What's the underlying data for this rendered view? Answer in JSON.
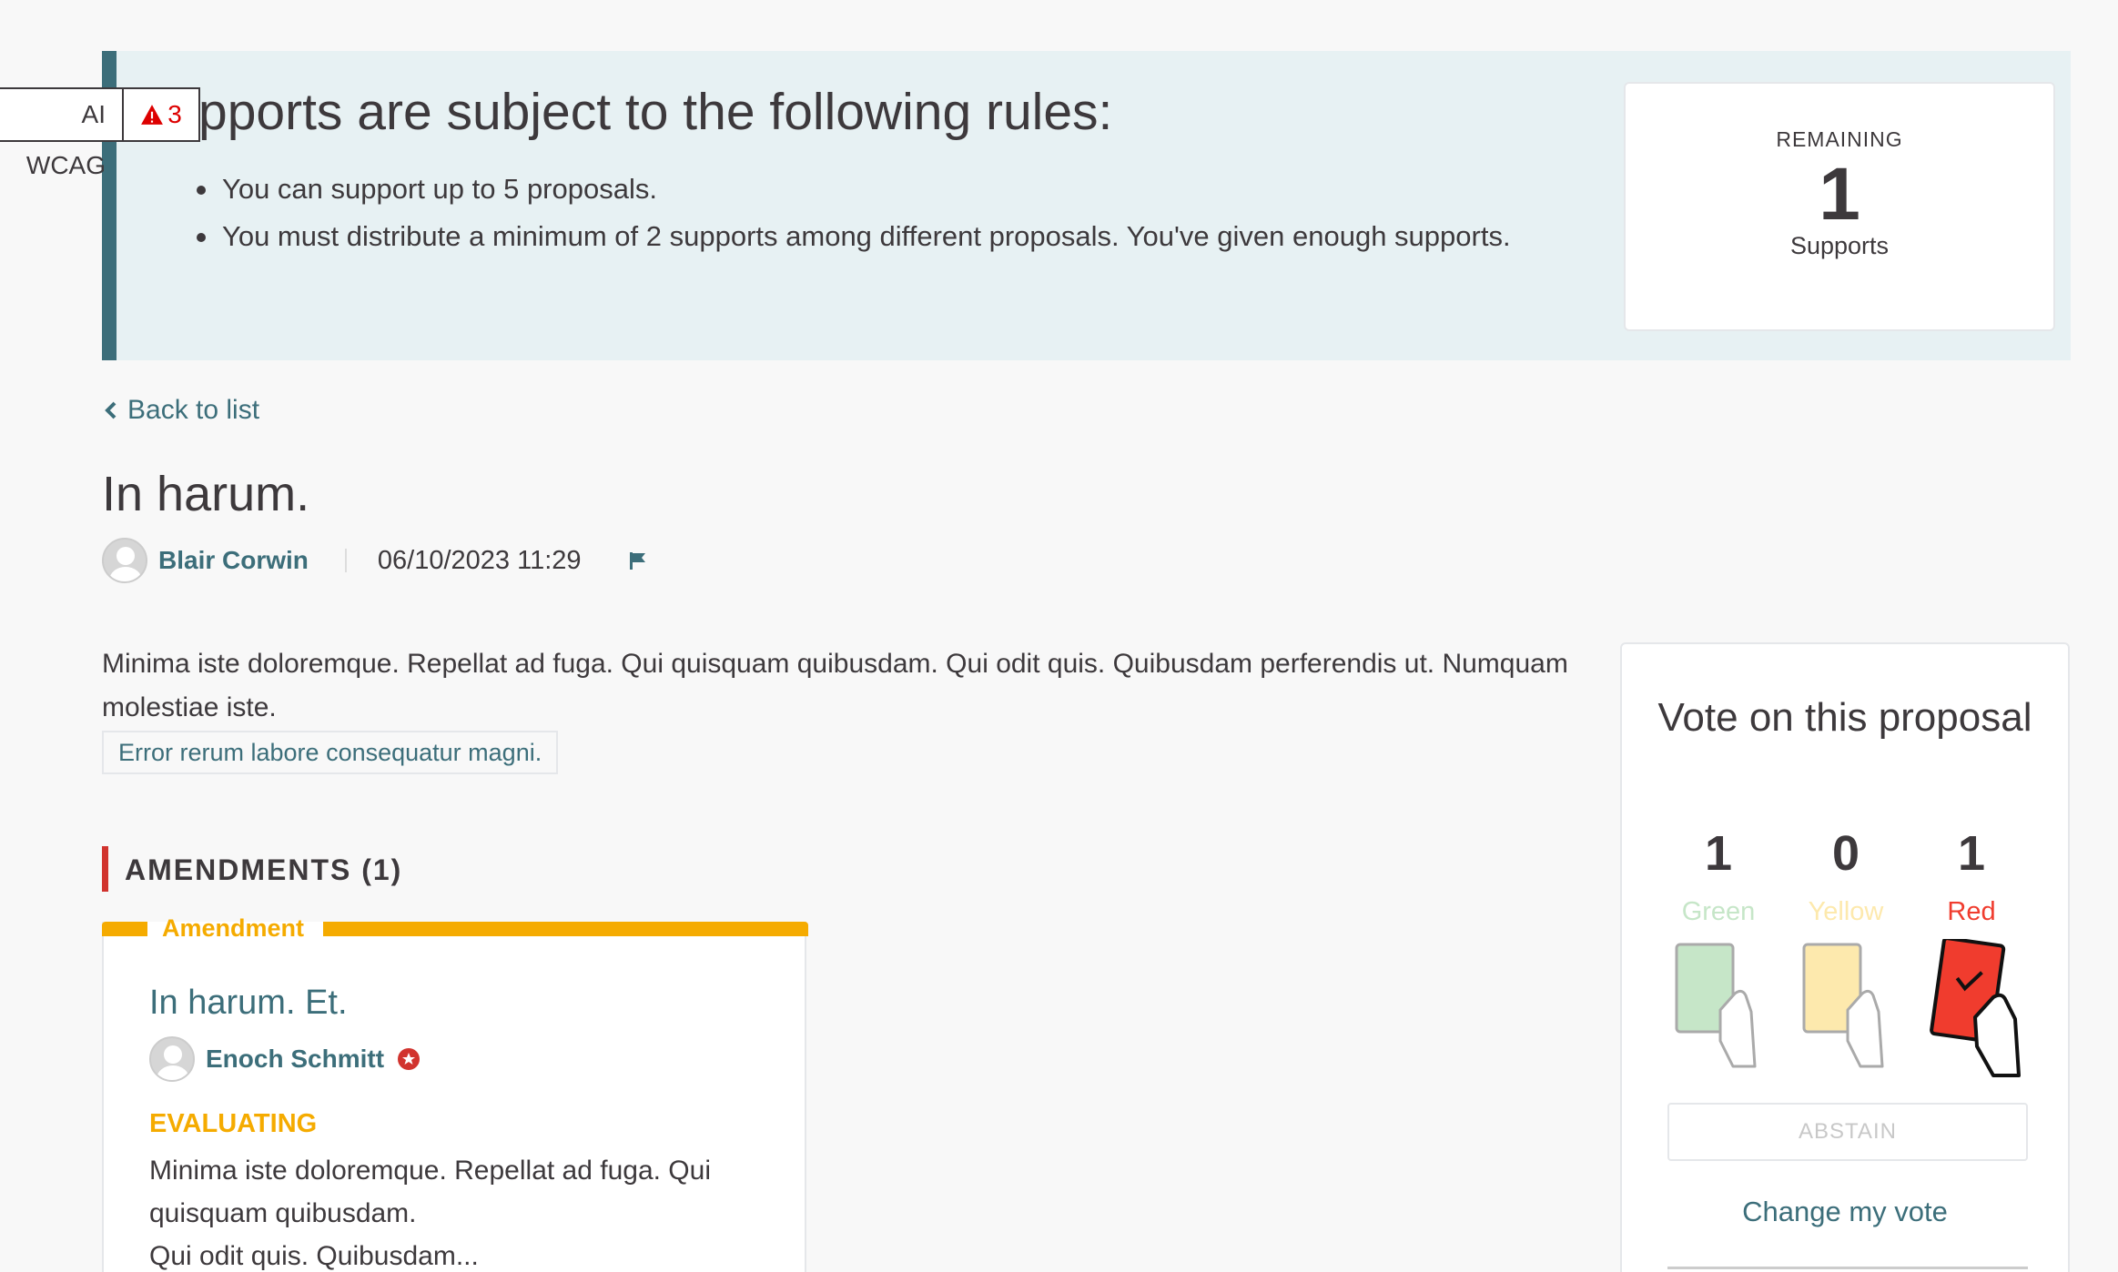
{
  "callout": {
    "title": "pports are subject to the following rules:",
    "rules": [
      "You can support up to 5 proposals.",
      "You must distribute a minimum of 2 supports among different proposals. You've given enough supports."
    ],
    "remaining": {
      "label": "REMAINING",
      "count": "1",
      "unit": "Supports"
    }
  },
  "wcag_badge": {
    "label": "AI WCAG",
    "count": "3"
  },
  "back_link": "Back to list",
  "proposal": {
    "title": "In harum.",
    "author": "Blair Corwin",
    "date": "06/10/2023 11:29",
    "body": "Minima iste doloremque. Repellat ad fuga. Qui quisquam quibusdam. Qui odit quis. Quibusdam perferendis ut. Numquam molestiae iste.",
    "hashtag": "Error rerum labore consequatur magni."
  },
  "amendments": {
    "heading": "AMENDMENTS (1)",
    "card": {
      "label": "Amendment",
      "title": "In harum. Et.",
      "author": "Enoch Schmitt",
      "status": "EVALUATING",
      "text": "Minima iste doloremque. Repellat ad fuga. Qui quisquam quibusdam.",
      "text2": "Qui odit quis. Quibusdam..."
    }
  },
  "vote_panel": {
    "title": "Vote on this proposal",
    "options": [
      {
        "count": "1",
        "label": "Green",
        "color": "#c6e6c8",
        "selected": false
      },
      {
        "count": "0",
        "label": "Yellow",
        "color": "#fde9ad",
        "selected": false
      },
      {
        "count": "1",
        "label": "Red",
        "color": "#f03c2e",
        "selected": true
      }
    ],
    "abstain": "ABSTAIN",
    "change_vote": "Change my vote"
  },
  "colors": {
    "accent": "#3c6e7a",
    "callout_bg": "#e7f1f3",
    "amendment": "#f5ab00",
    "section_marker": "#d1332e"
  }
}
